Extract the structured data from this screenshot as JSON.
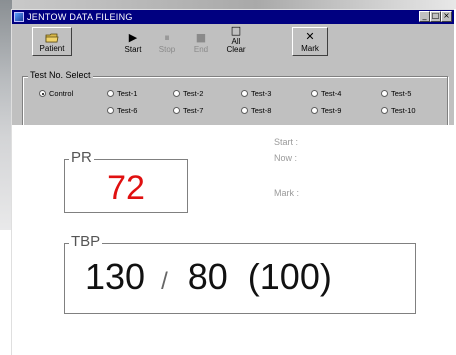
{
  "window": {
    "title": "JENTOW DATA FILEING",
    "buttons": {
      "minimize": "_",
      "maximize": "□",
      "close": "×"
    }
  },
  "toolbar": {
    "patient": {
      "label": "Patient",
      "icon": "folder-icon"
    },
    "start": {
      "label": "Start",
      "icon": "▶"
    },
    "stop": {
      "label": "Stop",
      "icon": "⏸"
    },
    "end": {
      "label": "End",
      "icon": "■"
    },
    "all_clear": {
      "label_line1": "All",
      "label_line2": "Clear",
      "icon": "□"
    },
    "mark": {
      "label": "Mark",
      "icon": "✕"
    }
  },
  "test_select": {
    "title": "Test No. Select",
    "selected": "Control",
    "options": [
      "Control",
      "Test-1",
      "Test-2",
      "Test-3",
      "Test-4",
      "Test-5",
      "Test-6",
      "Test-7",
      "Test-8",
      "Test-9",
      "Test-10"
    ]
  },
  "monitor": {
    "pr": {
      "label": "PR",
      "value": "72",
      "value_color": "#e01010"
    },
    "start_label": "Start :",
    "now_label": "Now :",
    "mark_label": "Mark :",
    "tbp": {
      "label": "TBP",
      "systolic": "130",
      "separator": "/",
      "diastolic": "80",
      "mean": "(100)"
    }
  }
}
